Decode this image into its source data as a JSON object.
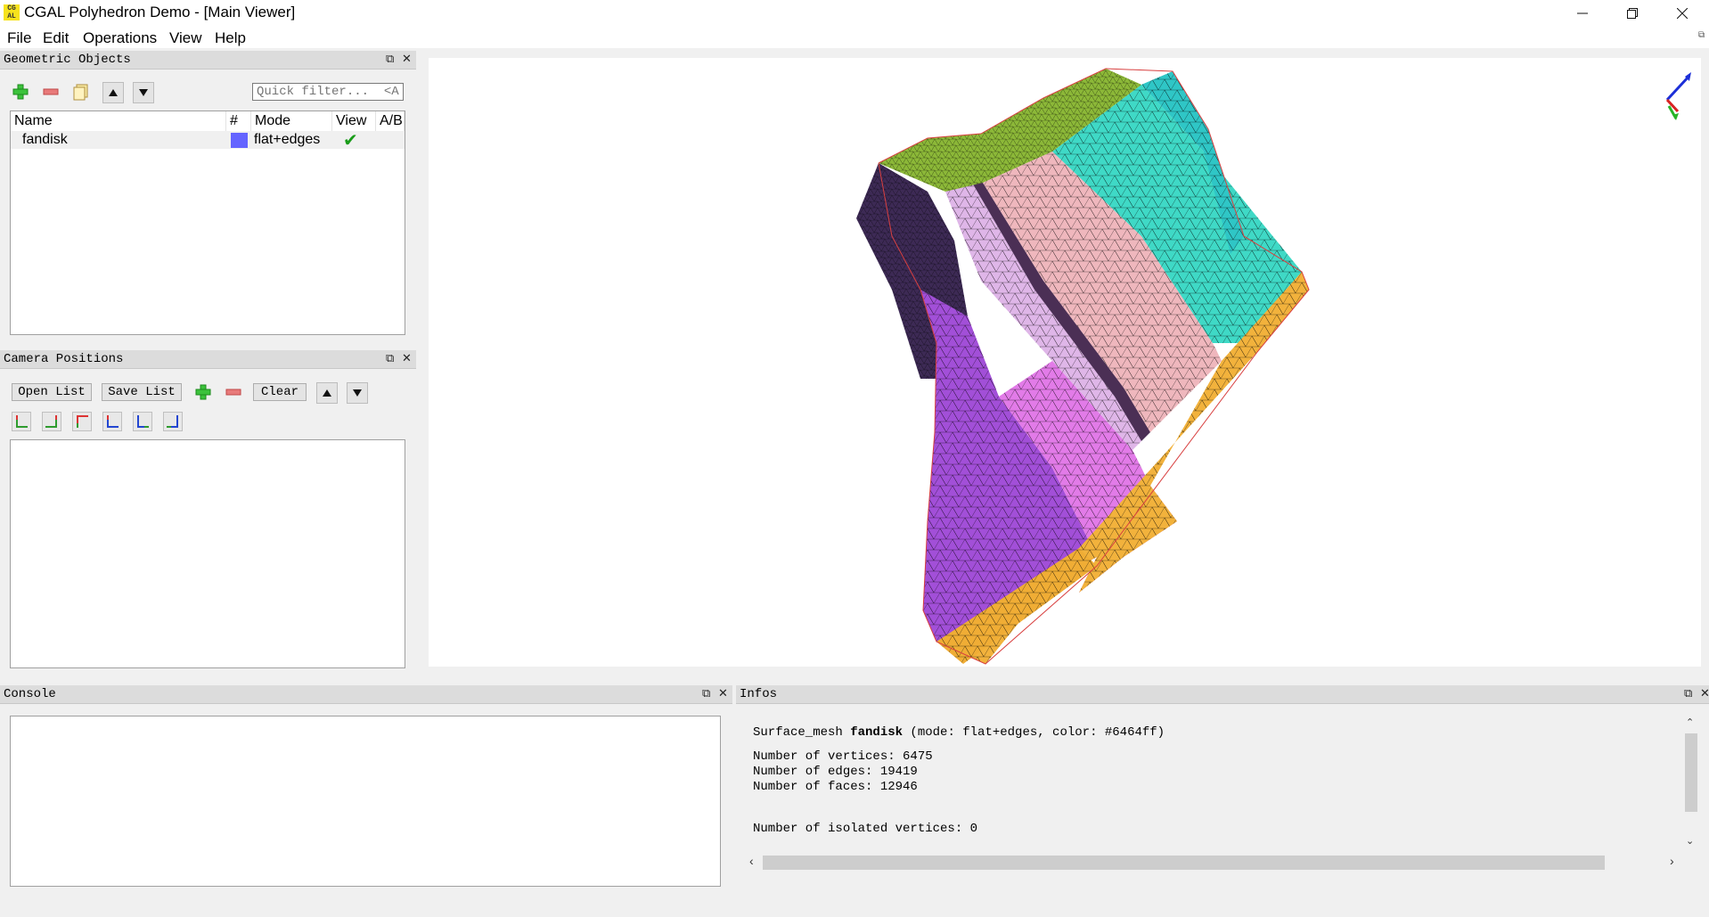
{
  "window": {
    "title": "CGAL Polyhedron Demo - [Main Viewer]",
    "icon_text": "CG AL",
    "controls": [
      "minimize-icon",
      "restore-icon",
      "close-icon"
    ]
  },
  "menu": {
    "items": [
      {
        "label": "File"
      },
      {
        "label": "Edit"
      },
      {
        "label": "Operations"
      },
      {
        "label": "View"
      },
      {
        "label": "Help"
      }
    ]
  },
  "geometric_objects": {
    "title": "Geometric Objects",
    "filter_placeholder": "Quick filter...  <A⋯",
    "columns": [
      "Name",
      "#",
      "Mode",
      "View",
      "A/B"
    ],
    "rows": [
      {
        "name": "fandisk",
        "color": "#6464ff",
        "mode": "flat+edges",
        "visible": "✔",
        "ab": ""
      }
    ]
  },
  "camera_positions": {
    "title": "Camera Positions",
    "open_list": "Open List",
    "save_list": "Save List",
    "clear": "Clear"
  },
  "console": {
    "title": "Console"
  },
  "infos": {
    "title": "Infos",
    "header_prefix": "Surface_mesh ",
    "object_name": "fandisk",
    "header_suffix": " (mode: flat+edges, color: #6464ff)",
    "vertices": "Number of vertices: 6475",
    "edges": "Number of edges: 19419",
    "faces": "Number of faces: 12946",
    "isolated": "Number of isolated vertices: 0"
  },
  "colors": {
    "mesh_pink": "#e27be8",
    "mesh_cyan": "#3fd9c6",
    "mesh_orange": "#f2b23c",
    "mesh_green": "#8cb838",
    "mesh_light": "#efc0e0",
    "check_green": "#1a9c1a"
  }
}
